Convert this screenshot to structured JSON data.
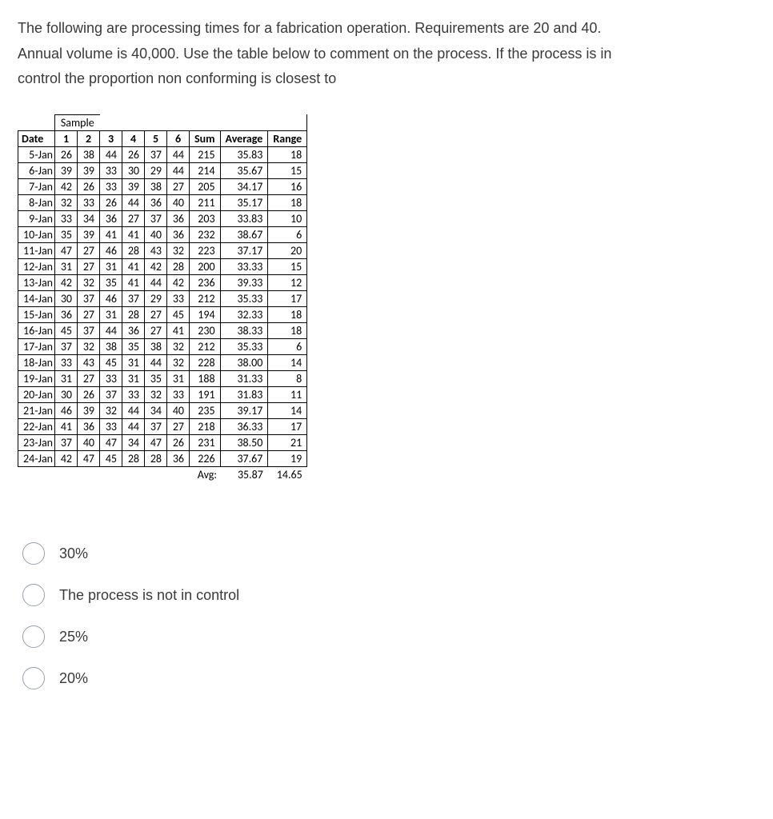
{
  "question": {
    "line1": "The following are processing times for a fabrication operation. Requirements are 20 and 40.",
    "line2": "Annual volume is 40,000. Use the table below to comment on the process. If the process is in",
    "line3": "control the proportion non conforming is closest to"
  },
  "table": {
    "sample_label": "Sample",
    "headers": [
      "Date",
      "1",
      "2",
      "3",
      "4",
      "5",
      "6",
      "Sum",
      "Average",
      "Range"
    ],
    "rows": [
      [
        "5-Jan",
        "26",
        "38",
        "44",
        "26",
        "37",
        "44",
        "215",
        "35.83",
        "18"
      ],
      [
        "6-Jan",
        "39",
        "39",
        "33",
        "30",
        "29",
        "44",
        "214",
        "35.67",
        "15"
      ],
      [
        "7-Jan",
        "42",
        "26",
        "33",
        "39",
        "38",
        "27",
        "205",
        "34.17",
        "16"
      ],
      [
        "8-Jan",
        "32",
        "33",
        "26",
        "44",
        "36",
        "40",
        "211",
        "35.17",
        "18"
      ],
      [
        "9-Jan",
        "33",
        "34",
        "36",
        "27",
        "37",
        "36",
        "203",
        "33.83",
        "10"
      ],
      [
        "10-Jan",
        "35",
        "39",
        "41",
        "41",
        "40",
        "36",
        "232",
        "38.67",
        "6"
      ],
      [
        "11-Jan",
        "47",
        "27",
        "46",
        "28",
        "43",
        "32",
        "223",
        "37.17",
        "20"
      ],
      [
        "12-Jan",
        "31",
        "27",
        "31",
        "41",
        "42",
        "28",
        "200",
        "33.33",
        "15"
      ],
      [
        "13-Jan",
        "42",
        "32",
        "35",
        "41",
        "44",
        "42",
        "236",
        "39.33",
        "12"
      ],
      [
        "14-Jan",
        "30",
        "37",
        "46",
        "37",
        "29",
        "33",
        "212",
        "35.33",
        "17"
      ],
      [
        "15-Jan",
        "36",
        "27",
        "31",
        "28",
        "27",
        "45",
        "194",
        "32.33",
        "18"
      ],
      [
        "16-Jan",
        "45",
        "37",
        "44",
        "36",
        "27",
        "41",
        "230",
        "38.33",
        "18"
      ],
      [
        "17-Jan",
        "37",
        "32",
        "38",
        "35",
        "38",
        "32",
        "212",
        "35.33",
        "6"
      ],
      [
        "18-Jan",
        "33",
        "43",
        "45",
        "31",
        "44",
        "32",
        "228",
        "38.00",
        "14"
      ],
      [
        "19-Jan",
        "31",
        "27",
        "33",
        "31",
        "35",
        "31",
        "188",
        "31.33",
        "8"
      ],
      [
        "20-Jan",
        "30",
        "26",
        "37",
        "33",
        "32",
        "33",
        "191",
        "31.83",
        "11"
      ],
      [
        "21-Jan",
        "46",
        "39",
        "32",
        "44",
        "34",
        "40",
        "235",
        "39.17",
        "14"
      ],
      [
        "22-Jan",
        "41",
        "36",
        "33",
        "44",
        "37",
        "27",
        "218",
        "36.33",
        "17"
      ],
      [
        "23-Jan",
        "37",
        "40",
        "47",
        "34",
        "47",
        "26",
        "231",
        "38.50",
        "21"
      ],
      [
        "24-Jan",
        "42",
        "47",
        "45",
        "28",
        "28",
        "36",
        "226",
        "37.67",
        "19"
      ]
    ],
    "avg_label": "Avg:",
    "avg_average": "35.87",
    "avg_range": "14.65"
  },
  "options": [
    "30%",
    "The process is not in control",
    "25%",
    "20%"
  ]
}
